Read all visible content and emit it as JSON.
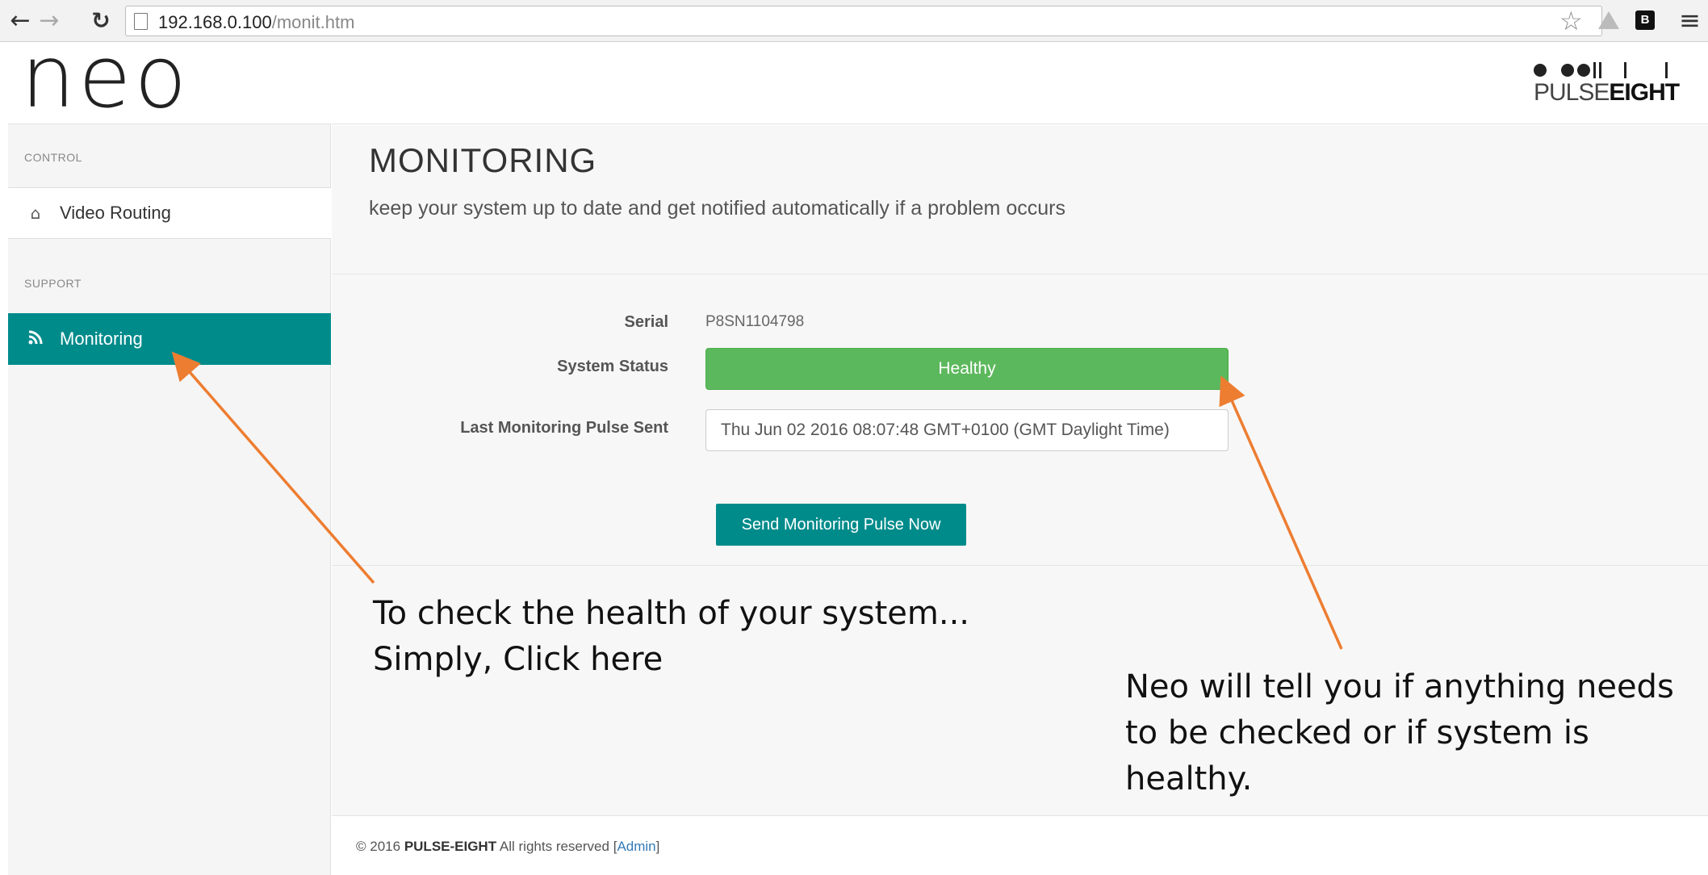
{
  "browser": {
    "url_host": "192.168.0.100",
    "url_path": "/monit.htm",
    "icons": [
      "back-arrow-icon",
      "forward-arrow-icon",
      "reload-icon",
      "page-icon",
      "star-icon",
      "drive-extension-icon",
      "b-extension-icon",
      "menu-icon"
    ]
  },
  "app": {
    "logo": "neo",
    "partner_logo": {
      "prefix": "PULSE",
      "bold": "EIGHT"
    }
  },
  "sidebar": {
    "sections": [
      {
        "title": "CONTROL",
        "items": [
          {
            "label": "Video Routing",
            "icon": "home-icon"
          }
        ]
      },
      {
        "title": "SUPPORT",
        "items": [
          {
            "label": "Monitoring",
            "icon": "rss-icon",
            "active": true
          }
        ]
      }
    ]
  },
  "page": {
    "title": "MONITORING",
    "subtitle": "keep your system up to date and get notified automatically if a problem occurs"
  },
  "form": {
    "serial_label": "Serial",
    "serial_value": "P8SN1104798",
    "status_label": "System Status",
    "status_value": "Healthy",
    "pulse_label": "Last Monitoring Pulse Sent",
    "pulse_value": "Thu Jun 02 2016 08:07:48 GMT+0100 (GMT Daylight Time)",
    "send_button": "Send Monitoring Pulse Now"
  },
  "footer": {
    "copyright": "© 2016",
    "company": "PULSE-EIGHT",
    "rights": "All rights reserved",
    "admin_open": "[",
    "admin_link": "Admin",
    "admin_close": "]"
  },
  "annotations": {
    "left_line1": "To check the health of your system...",
    "left_line2": "Simply, Click here",
    "right_line1": "Neo will tell you if anything needs",
    "right_line2": "to be checked or if system is",
    "right_line3": "healthy.",
    "arrow_color": "#ed7d31"
  },
  "colors": {
    "accent": "#008b8b",
    "healthy": "#5cb85c",
    "link": "#337ab7"
  }
}
